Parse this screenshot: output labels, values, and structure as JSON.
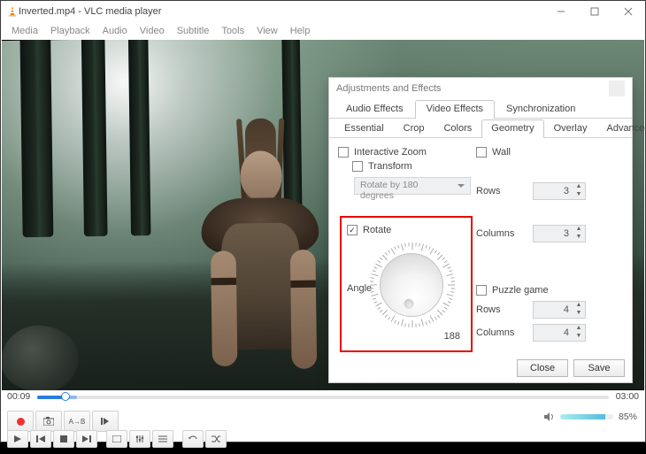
{
  "window": {
    "title": "Inverted.mp4 - VLC media player"
  },
  "menu": [
    "Media",
    "Playback",
    "Audio",
    "Video",
    "Subtitle",
    "Tools",
    "View",
    "Help"
  ],
  "dialog": {
    "title": "Adjustments and Effects",
    "tabs": [
      "Audio Effects",
      "Video Effects",
      "Synchronization"
    ],
    "active_tab": "Video Effects",
    "subtabs": [
      "Essential",
      "Crop",
      "Colors",
      "Geometry",
      "Overlay",
      "Advanced"
    ],
    "active_subtab": "Geometry",
    "geometry": {
      "interactive_zoom": {
        "label": "Interactive Zoom",
        "checked": false
      },
      "transform": {
        "label": "Transform",
        "checked": false,
        "option": "Rotate by 180 degrees"
      },
      "rotate": {
        "label": "Rotate",
        "checked": true,
        "angle_label": "Angle",
        "value": "188"
      },
      "wall": {
        "label": "Wall",
        "checked": false,
        "rows_label": "Rows",
        "rows": "3",
        "cols_label": "Columns",
        "cols": "3"
      },
      "puzzle": {
        "label": "Puzzle game",
        "checked": false,
        "rows_label": "Rows",
        "rows": "4",
        "cols_label": "Columns",
        "cols": "4"
      }
    },
    "close": "Close",
    "save": "Save"
  },
  "player": {
    "elapsed": "00:09",
    "total": "03:00",
    "volume": "85%"
  }
}
